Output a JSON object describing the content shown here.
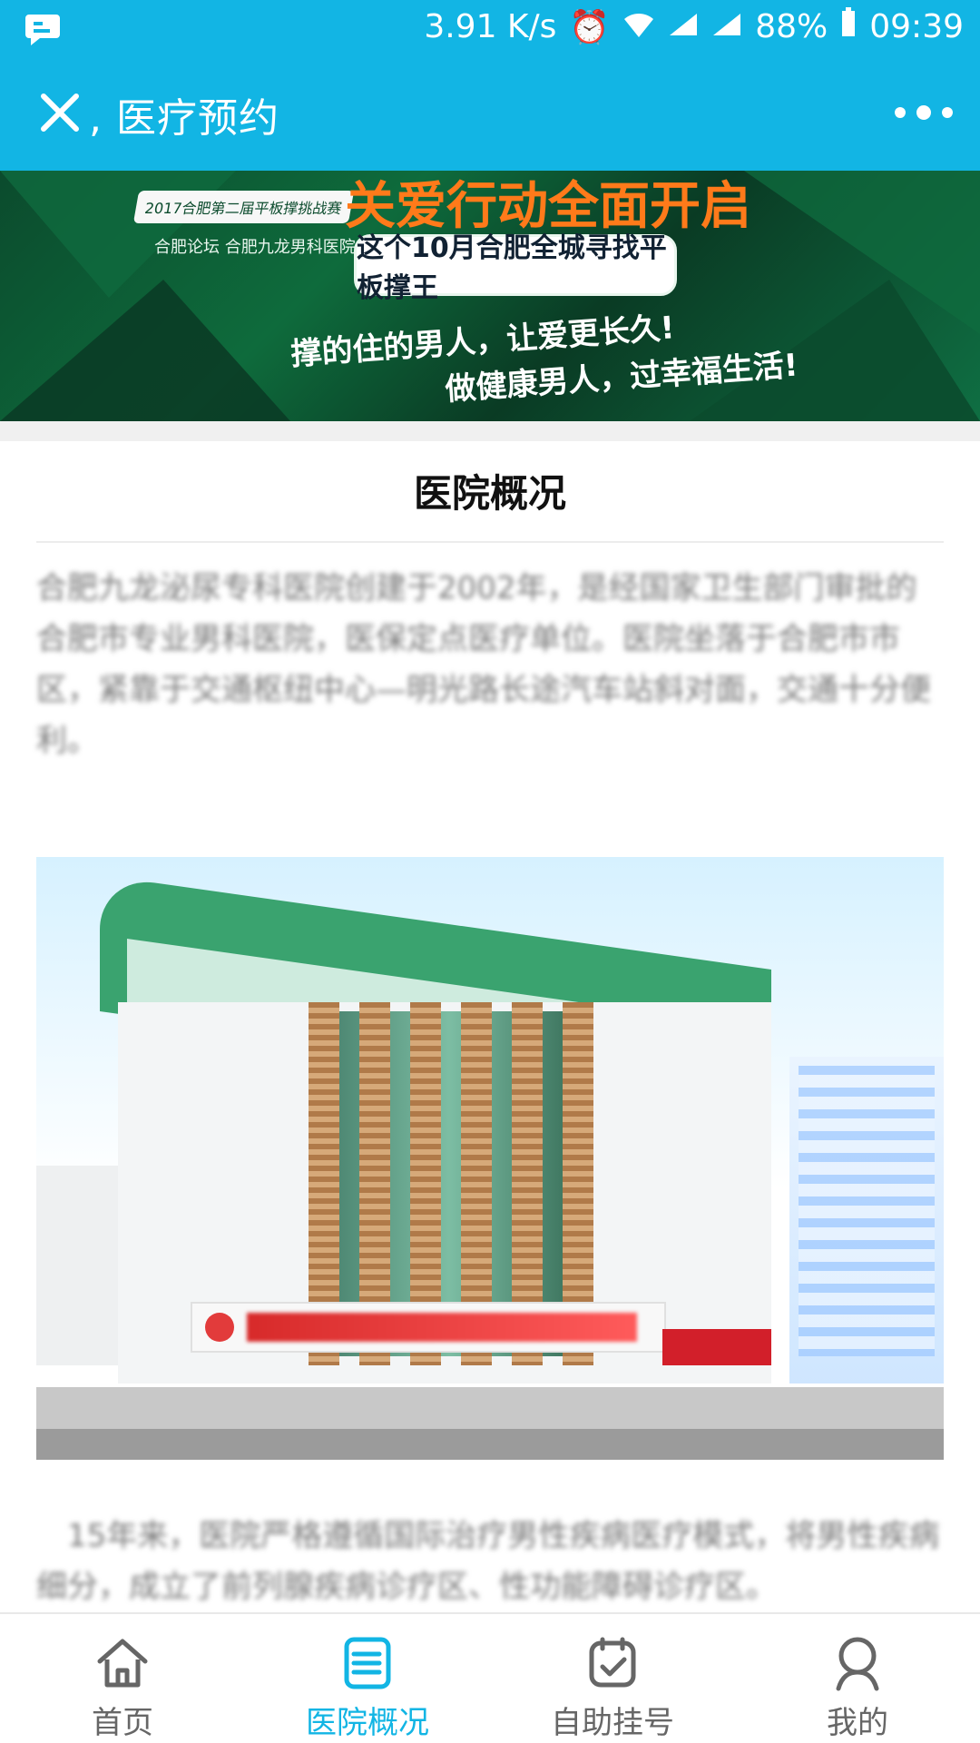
{
  "status_bar": {
    "network_speed": "3.91 K/s",
    "battery": "88%",
    "time": "09:39"
  },
  "app_bar": {
    "title": ", 医疗预约"
  },
  "banner": {
    "headline": "关爱行动全面开启",
    "badge_text": "2017合肥第二届平板撑挑战赛",
    "logos_text": "合肥论坛  合肥九龙男科医院",
    "pill_text": "这个10月合肥全城寻找平板撑王",
    "slogan_1": "撑的住的男人，让爱更长久!",
    "slogan_2": "做健康男人，过幸福生活!"
  },
  "content": {
    "section_title": "医院概况",
    "paragraph_1": "合肥九龙泌尿专科医院创建于2002年，是经国家卫生部门审批的合肥市专业男科医院，医保定点医疗单位。医院坐落于合肥市市区，紧靠于交通枢纽中心—明光路长途汽车站斜对面，交通十分便利。",
    "paragraph_2": "15年来，医院严格遵循国际治疗男性疾病医疗模式，将男性疾病细分，成立了前列腺疾病诊疗区、性功能障碍诊疗区。"
  },
  "bottom_nav": {
    "items": [
      {
        "label": "首页"
      },
      {
        "label": "医院概况"
      },
      {
        "label": "自助挂号"
      },
      {
        "label": "我的"
      }
    ],
    "active_color": "#12b5e4"
  },
  "colors": {
    "accent": "#12b5e4"
  }
}
